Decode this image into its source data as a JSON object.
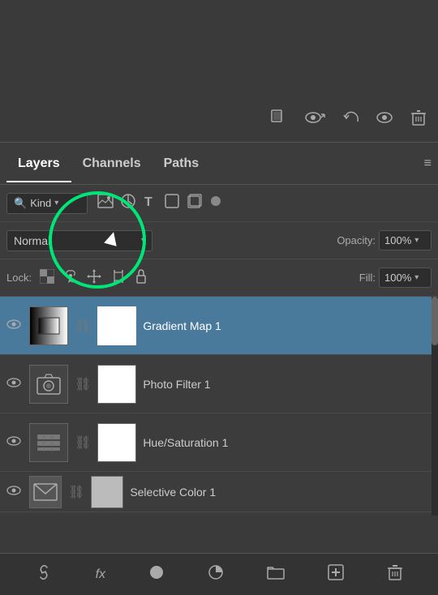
{
  "toolbar": {
    "icons": [
      "selection-icon",
      "visibility-icon",
      "undo-icon",
      "eye-icon",
      "trash-icon"
    ]
  },
  "tabs": {
    "items": [
      {
        "label": "Layers",
        "active": true
      },
      {
        "label": "Channels",
        "active": false
      },
      {
        "label": "Paths",
        "active": false
      }
    ],
    "menu_icon": "≡"
  },
  "kind_row": {
    "search_icon": "🔍",
    "kind_label": "Kind",
    "chevron": "▾"
  },
  "blend_row": {
    "blend_mode": "Normal",
    "blend_chevron": "▾",
    "opacity_label": "Opacity:",
    "opacity_value": "100%",
    "opacity_chevron": "▾"
  },
  "lock_row": {
    "lock_label": "Lock:",
    "fill_label": "Fill:",
    "fill_value": "100%",
    "fill_chevron": "▾"
  },
  "layers": [
    {
      "name": "Gradient Map 1",
      "visible": true,
      "selected": true,
      "thumb_type": "gradient-map",
      "has_white": true
    },
    {
      "name": "Photo Filter 1",
      "visible": true,
      "selected": false,
      "thumb_type": "camera",
      "has_white": true
    },
    {
      "name": "Hue/Saturation 1",
      "visible": true,
      "selected": false,
      "thumb_type": "hue-sat",
      "has_white": true
    },
    {
      "name": "Selective Color 1",
      "visible": true,
      "selected": false,
      "thumb_type": "selective",
      "has_white": true
    }
  ],
  "bottom_bar": {
    "link_icon": "🔗",
    "fx_label": "fx",
    "circle_icon": "●",
    "circle_half_icon": "◑",
    "folder_icon": "📁",
    "add_icon": "+",
    "trash_icon": "🗑"
  }
}
